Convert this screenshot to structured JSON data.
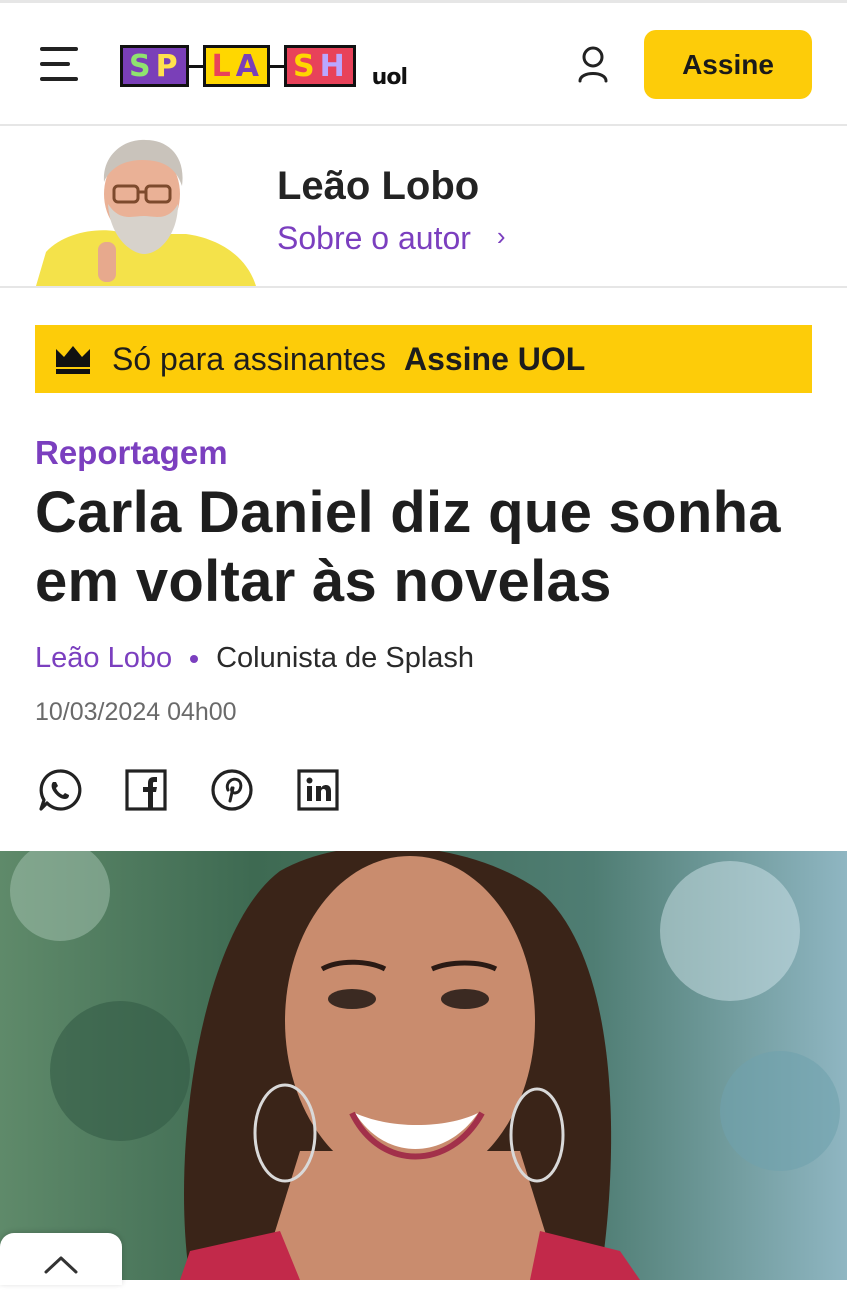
{
  "header": {
    "logo_letters": [
      "S",
      "P",
      "L",
      "A",
      "S",
      "H"
    ],
    "logo_sub": "uol",
    "subscribe_label": "Assine",
    "icons": {
      "menu": "hamburger-menu-icon",
      "user": "user-icon"
    }
  },
  "author": {
    "name": "Leão Lobo",
    "link_label": "Sobre o autor",
    "link_chevron": "›"
  },
  "subscriber_banner": {
    "text": "Só para assinantes",
    "cta": "Assine UOL",
    "icon": "crown-icon"
  },
  "article": {
    "kicker": "Reportagem",
    "title": "Carla Daniel diz que sonha em voltar às novelas",
    "byline_author": "Leão Lobo",
    "byline_role": "Colunista de Splash",
    "date": "10/03/2024 04h00"
  },
  "share": [
    "whatsapp-icon",
    "facebook-icon",
    "pinterest-icon",
    "linkedin-icon"
  ],
  "colors": {
    "accent_purple": "#7b3fbf",
    "brand_yellow": "#fdcc09",
    "text_dark": "#1e1e1e"
  }
}
